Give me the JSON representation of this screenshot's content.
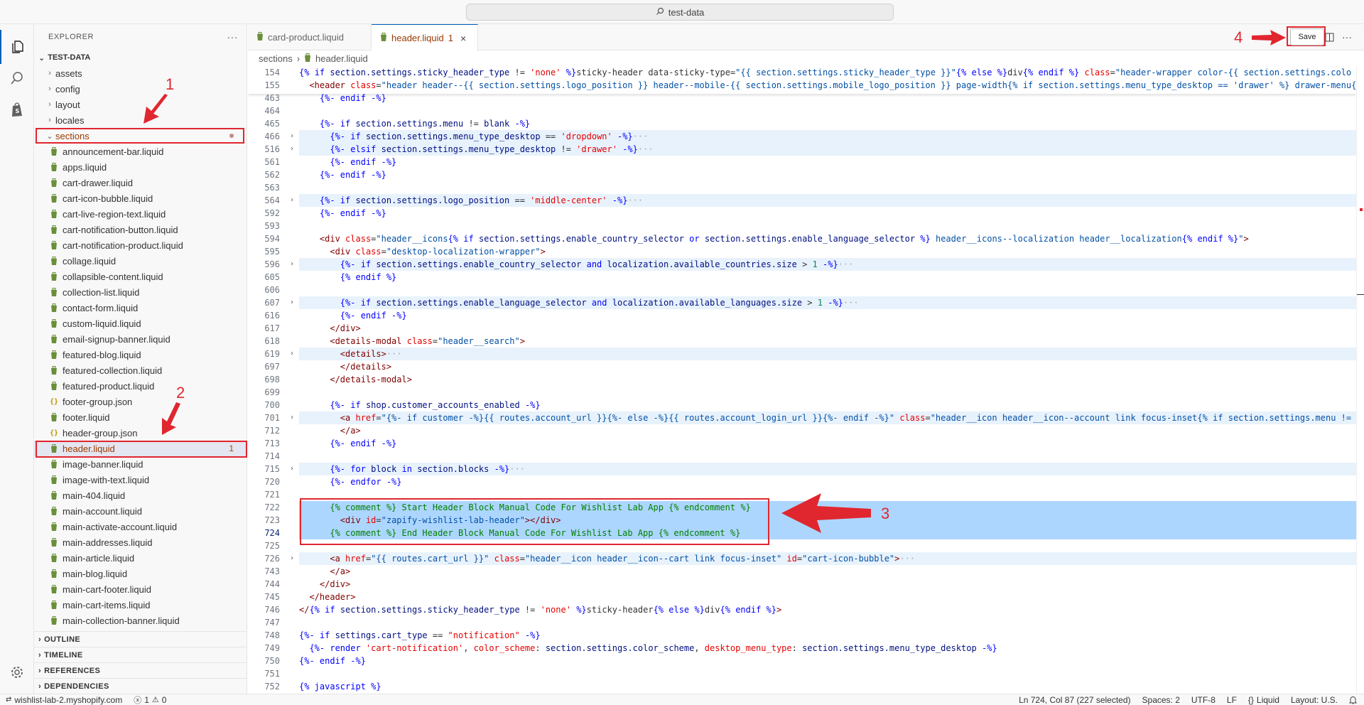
{
  "titlebar": {
    "search": "test-data"
  },
  "sidebar": {
    "title": "EXPLORER",
    "more": "···",
    "folder": "TEST-DATA",
    "items": [
      {
        "label": "assets",
        "type": "folder"
      },
      {
        "label": "config",
        "type": "folder"
      },
      {
        "label": "layout",
        "type": "folder"
      },
      {
        "label": "locales",
        "type": "folder"
      },
      {
        "label": "sections",
        "type": "folder-open"
      },
      {
        "label": "announcement-bar.liquid",
        "type": "liquid"
      },
      {
        "label": "apps.liquid",
        "type": "liquid"
      },
      {
        "label": "cart-drawer.liquid",
        "type": "liquid"
      },
      {
        "label": "cart-icon-bubble.liquid",
        "type": "liquid"
      },
      {
        "label": "cart-live-region-text.liquid",
        "type": "liquid"
      },
      {
        "label": "cart-notification-button.liquid",
        "type": "liquid"
      },
      {
        "label": "cart-notification-product.liquid",
        "type": "liquid"
      },
      {
        "label": "collage.liquid",
        "type": "liquid"
      },
      {
        "label": "collapsible-content.liquid",
        "type": "liquid"
      },
      {
        "label": "collection-list.liquid",
        "type": "liquid"
      },
      {
        "label": "contact-form.liquid",
        "type": "liquid"
      },
      {
        "label": "custom-liquid.liquid",
        "type": "liquid"
      },
      {
        "label": "email-signup-banner.liquid",
        "type": "liquid"
      },
      {
        "label": "featured-blog.liquid",
        "type": "liquid"
      },
      {
        "label": "featured-collection.liquid",
        "type": "liquid"
      },
      {
        "label": "featured-product.liquid",
        "type": "liquid"
      },
      {
        "label": "footer-group.json",
        "type": "json"
      },
      {
        "label": "footer.liquid",
        "type": "liquid"
      },
      {
        "label": "header-group.json",
        "type": "json"
      },
      {
        "label": "header.liquid",
        "type": "liquid",
        "badge": "1"
      },
      {
        "label": "image-banner.liquid",
        "type": "liquid"
      },
      {
        "label": "image-with-text.liquid",
        "type": "liquid"
      },
      {
        "label": "main-404.liquid",
        "type": "liquid"
      },
      {
        "label": "main-account.liquid",
        "type": "liquid"
      },
      {
        "label": "main-activate-account.liquid",
        "type": "liquid"
      },
      {
        "label": "main-addresses.liquid",
        "type": "liquid"
      },
      {
        "label": "main-article.liquid",
        "type": "liquid"
      },
      {
        "label": "main-blog.liquid",
        "type": "liquid"
      },
      {
        "label": "main-cart-footer.liquid",
        "type": "liquid"
      },
      {
        "label": "main-cart-items.liquid",
        "type": "liquid"
      },
      {
        "label": "main-collection-banner.liquid",
        "type": "liquid"
      }
    ],
    "bottom": [
      "OUTLINE",
      "TIMELINE",
      "REFERENCES",
      "DEPENDENCIES"
    ]
  },
  "tabs": [
    {
      "label": "card-product.liquid"
    },
    {
      "label": "header.liquid",
      "badge": "1"
    }
  ],
  "toolbar": {
    "save_label": "Save"
  },
  "breadcrumb": {
    "folder": "sections",
    "file": "header.liquid"
  },
  "annotations": {
    "n1": "1",
    "n2": "2",
    "n3": "3",
    "n4": "4"
  },
  "status": {
    "remote": "wishlist-lab-2.myshopify.com",
    "errors": "1",
    "warnings": "0",
    "position": "Ln 724, Col 87 (227 selected)",
    "spaces": "Spaces: 2",
    "encoding": "UTF-8",
    "eol": "LF",
    "language": "Liquid",
    "layout": "Layout: U.S."
  },
  "code_lines": [
    {
      "n": "154",
      "html": "<span class=\"k\">{%</span> <span class=\"k\">if</span> <span class=\"v\">section.settings.sticky_header_type</span> != <span class=\"a\">'none'</span> <span class=\"k\">%}</span>sticky-header data-sticky-type=<span class=\"s\">\"{{ section.settings.sticky_header_type }}\"</span><span class=\"k\">{% else %}</span>div<span class=\"k\">{% endif %}</span> <span class=\"a\">class</span>=<span class=\"s\">\"header-wrapper color-{{ section.settings.colo</span>"
    },
    {
      "n": "155",
      "html": "  <span class=\"t\">&lt;header</span> <span class=\"a\">class</span>=<span class=\"s\">\"header header--{{ section.settings.logo_position }} header--mobile-{{ section.settings.mobile_logo_position }} page-width{% if section.settings.menu_type_desktop == 'drawer' %} drawer-menu{</span>"
    },
    {
      "n": "463",
      "html": "    <span class=\"k\">{%- endif -%}</span>"
    },
    {
      "n": "464",
      "html": ""
    },
    {
      "n": "465",
      "html": "    <span class=\"k\">{%- if</span> <span class=\"v\">section.settings.menu</span> != <span class=\"v\">blank</span> <span class=\"k\">-%}</span>"
    },
    {
      "n": "466",
      "fold": true,
      "html": "      <span class=\"k\">{%- if</span> <span class=\"v\">section.settings.menu_type_desktop</span> == <span class=\"a\">'dropdown'</span> <span class=\"k\">-%}</span><span class=\"m\">···</span>"
    },
    {
      "n": "516",
      "fold": true,
      "html": "      <span class=\"k\">{%- elsif</span> <span class=\"v\">section.settings.menu_type_desktop</span> != <span class=\"a\">'drawer'</span> <span class=\"k\">-%}</span><span class=\"m\">···</span>"
    },
    {
      "n": "561",
      "html": "      <span class=\"k\">{%- endif -%}</span>"
    },
    {
      "n": "562",
      "html": "    <span class=\"k\">{%- endif -%}</span>"
    },
    {
      "n": "563",
      "html": ""
    },
    {
      "n": "564",
      "fold": true,
      "html": "    <span class=\"k\">{%- if</span> <span class=\"v\">section.settings.logo_position</span> == <span class=\"a\">'middle-center'</span> <span class=\"k\">-%}</span><span class=\"m\">···</span>"
    },
    {
      "n": "592",
      "html": "    <span class=\"k\">{%- endif -%}</span>"
    },
    {
      "n": "593",
      "html": ""
    },
    {
      "n": "594",
      "html": "    <span class=\"t\">&lt;div</span> <span class=\"a\">class</span>=<span class=\"s\">\"header__icons</span><span class=\"k\">{%</span> <span class=\"k\">if</span> <span class=\"v\">section.settings.enable_country_selector</span> <span class=\"k\">or</span> <span class=\"v\">section.settings.enable_language_selector</span> <span class=\"k\">%}</span><span class=\"s\"> header__icons--localization header__localization</span><span class=\"k\">{% endif %}</span><span class=\"s\">\"</span><span class=\"t\">&gt;</span>"
    },
    {
      "n": "595",
      "html": "      <span class=\"t\">&lt;div</span> <span class=\"a\">class</span>=<span class=\"s\">\"desktop-localization-wrapper\"</span><span class=\"t\">&gt;</span>"
    },
    {
      "n": "596",
      "fold": true,
      "html": "        <span class=\"k\">{%- if</span> <span class=\"v\">section.settings.enable_country_selector</span> <span class=\"k\">and</span> <span class=\"v\">localization.available_countries.size</span> &gt; <span class=\"n\">1</span> <span class=\"k\">-%}</span><span class=\"m\">···</span>"
    },
    {
      "n": "605",
      "html": "        <span class=\"k\">{% endif %}</span>"
    },
    {
      "n": "606",
      "html": ""
    },
    {
      "n": "607",
      "fold": true,
      "html": "        <span class=\"k\">{%- if</span> <span class=\"v\">section.settings.enable_language_selector</span> <span class=\"k\">and</span> <span class=\"v\">localization.available_languages.size</span> &gt; <span class=\"n\">1</span> <span class=\"k\">-%}</span><span class=\"m\">···</span>"
    },
    {
      "n": "616",
      "html": "        <span class=\"k\">{%- endif -%}</span>"
    },
    {
      "n": "617",
      "html": "      <span class=\"t\">&lt;/div&gt;</span>"
    },
    {
      "n": "618",
      "html": "      <span class=\"t\">&lt;details-modal</span> <span class=\"a\">class</span>=<span class=\"s\">\"header__search\"</span><span class=\"t\">&gt;</span>"
    },
    {
      "n": "619",
      "fold": true,
      "html": "        <span class=\"t\">&lt;details&gt;</span><span class=\"m\">···</span>"
    },
    {
      "n": "697",
      "html": "        <span class=\"t\">&lt;/details&gt;</span>"
    },
    {
      "n": "698",
      "html": "      <span class=\"t\">&lt;/details-modal&gt;</span>"
    },
    {
      "n": "699",
      "html": ""
    },
    {
      "n": "700",
      "html": "      <span class=\"k\">{%- if</span> <span class=\"v\">shop.customer_accounts_enabled</span> <span class=\"k\">-%}</span>"
    },
    {
      "n": "701",
      "fold": true,
      "html": "        <span class=\"t\">&lt;a</span> <span class=\"a\">href</span>=<span class=\"s\">\"{%- if customer -%}{{ routes.account_url }}{%- else -%}{{ routes.account_login_url }}{%- endif -%}\"</span> <span class=\"a\">class</span>=<span class=\"s\">\"header__icon header__icon--account link focus-inset{% if section.settings.menu != bl</span>"
    },
    {
      "n": "712",
      "html": "        <span class=\"t\">&lt;/a&gt;</span>"
    },
    {
      "n": "713",
      "html": "      <span class=\"k\">{%- endif -%}</span>"
    },
    {
      "n": "714",
      "html": ""
    },
    {
      "n": "715",
      "fold": true,
      "html": "      <span class=\"k\">{%- for</span> <span class=\"v\">block</span> <span class=\"k\">in</span> <span class=\"v\">section.blocks</span> <span class=\"k\">-%}</span><span class=\"m\">···</span>"
    },
    {
      "n": "720",
      "html": "      <span class=\"k\">{%- endfor -%}</span>"
    },
    {
      "n": "721",
      "html": ""
    },
    {
      "n": "722",
      "sel": true,
      "html": "      <span class=\"c\">{% comment %} Start Header Block Manual Code For Wishlist Lab App {% endcomment %}</span>"
    },
    {
      "n": "723",
      "sel": true,
      "html": "        <span class=\"t\">&lt;div</span> <span class=\"a\">id</span>=<span class=\"s\">\"zapify-wishlist-lab-header\"</span><span class=\"t\">&gt;&lt;/div&gt;</span>"
    },
    {
      "n": "724",
      "sel": true,
      "cur": true,
      "html": "      <span class=\"c\">{% comment %} End Header Block Manual Code For Wishlist Lab App {% endcomment %}</span>"
    },
    {
      "n": "725",
      "html": ""
    },
    {
      "n": "726",
      "fold": true,
      "html": "      <span class=\"t\">&lt;a</span> <span class=\"a\">href</span>=<span class=\"s\">\"{{ routes.cart_url }}\"</span> <span class=\"a\">class</span>=<span class=\"s\">\"header__icon header__icon--cart link focus-inset\"</span> <span class=\"a\">id</span>=<span class=\"s\">\"cart-icon-bubble\"</span><span class=\"t\">&gt;</span><span class=\"m\">···</span>"
    },
    {
      "n": "743",
      "html": "      <span class=\"t\">&lt;/a&gt;</span>"
    },
    {
      "n": "744",
      "html": "    <span class=\"t\">&lt;/div&gt;</span>"
    },
    {
      "n": "745",
      "html": "  <span class=\"t\">&lt;/header&gt;</span>"
    },
    {
      "n": "746",
      "html": "<span class=\"t\">&lt;/</span><span class=\"k\">{%</span> <span class=\"k\">if</span> <span class=\"v\">section.settings.sticky_header_type</span> != <span class=\"a\">'none'</span> <span class=\"k\">%}</span>sticky-header<span class=\"k\">{% else %}</span>div<span class=\"k\">{% endif %}</span><span class=\"t\">&gt;</span>"
    },
    {
      "n": "747",
      "html": ""
    },
    {
      "n": "748",
      "html": "<span class=\"k\">{%- if</span> <span class=\"v\">settings.cart_type</span> == <span class=\"a\">\"notification\"</span> <span class=\"k\">-%}</span>"
    },
    {
      "n": "749",
      "html": "  <span class=\"k\">{%- render</span> <span class=\"a\">'cart-notification'</span>, <span class=\"a\">color_scheme</span>: <span class=\"v\">section.settings.color_scheme</span>, <span class=\"a\">desktop_menu_type</span>: <span class=\"v\">section.settings.menu_type_desktop</span> <span class=\"k\">-%}</span>"
    },
    {
      "n": "750",
      "html": "<span class=\"k\">{%- endif -%}</span>"
    },
    {
      "n": "751",
      "html": ""
    },
    {
      "n": "752",
      "html": "<span class=\"k\">{% javascript %}</span>"
    }
  ]
}
